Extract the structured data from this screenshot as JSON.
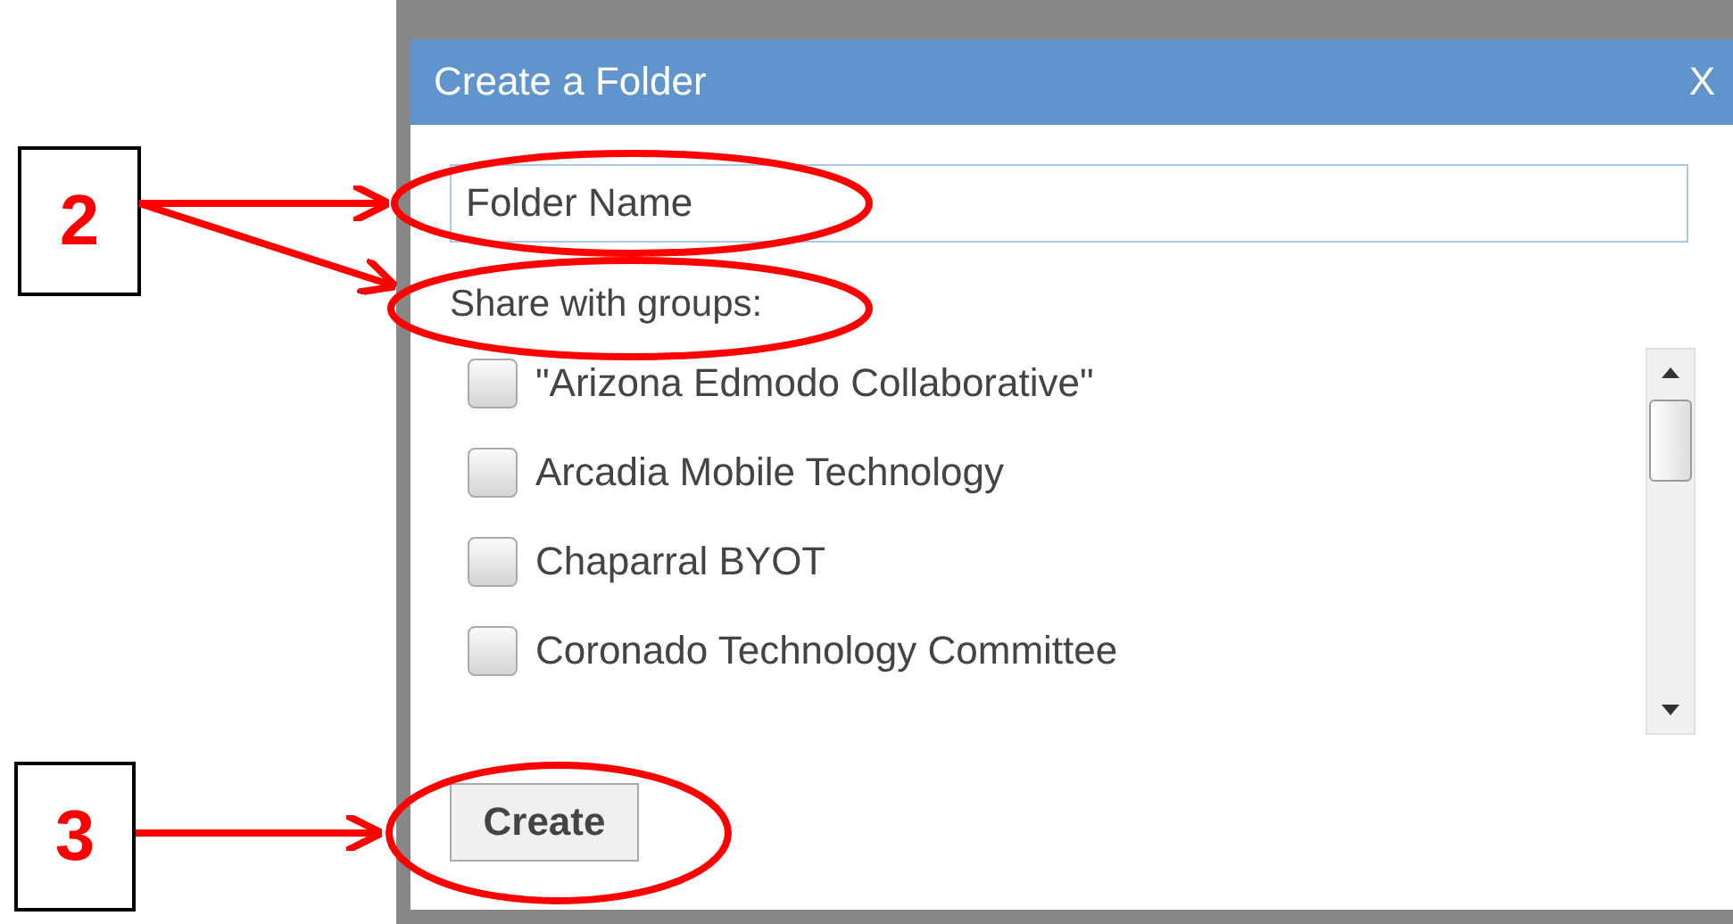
{
  "dialog": {
    "title": "Create a Folder",
    "close": "X",
    "folder_name": {
      "placeholder": "Folder Name"
    },
    "share_label": "Share with groups:",
    "groups": [
      {
        "label": "\"Arizona Edmodo Collaborative\"",
        "checked": false
      },
      {
        "label": "Arcadia Mobile Technology",
        "checked": false
      },
      {
        "label": "Chaparral BYOT",
        "checked": false
      },
      {
        "label": "Coronado Technology Committee",
        "checked": false
      }
    ],
    "create_button": "Create"
  },
  "callouts": [
    {
      "label": "2"
    },
    {
      "label": "3"
    }
  ]
}
